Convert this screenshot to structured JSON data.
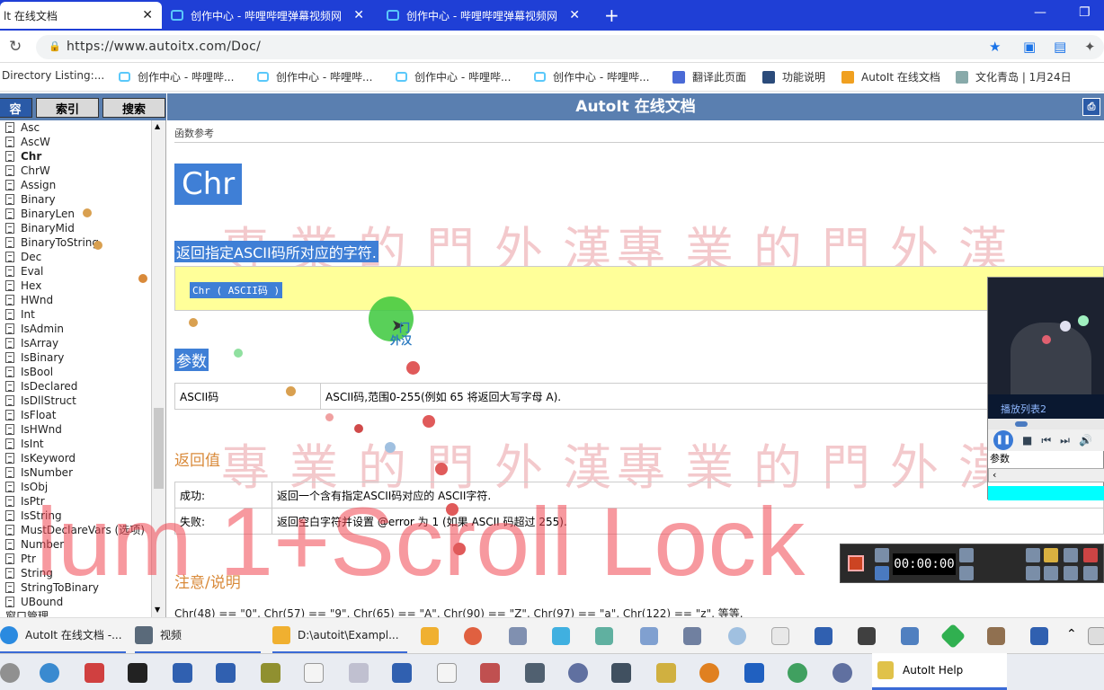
{
  "browser": {
    "tabs": [
      {
        "label": "lt 在线文档",
        "active": true
      },
      {
        "label": "创作中心 - 哔哩哔哩弹幕视频网",
        "active": false
      },
      {
        "label": "创作中心 - 哔哩哔哩弹幕视频网",
        "active": false
      }
    ],
    "new_tab": "+",
    "address": "https://www.autoitx.com/Doc/",
    "bookmarks": [
      "Directory Listing:...",
      "创作中心 - 哔哩哔...",
      "创作中心 - 哔哩哔...",
      "创作中心 - 哔哩哔...",
      "创作中心 - 哔哩哔...",
      "翻译此页面",
      "功能说明",
      "AutoIt 在线文档",
      "文化青岛 | 1月24日"
    ]
  },
  "left_pane": {
    "tabs": [
      "容",
      "索引",
      "搜索"
    ],
    "items": [
      "Asc",
      "AscW",
      "Chr",
      "ChrW",
      "Assign",
      "Binary",
      "BinaryLen",
      "BinaryMid",
      "BinaryToString",
      "Dec",
      "Eval",
      "Hex",
      "HWnd",
      "Int",
      "IsAdmin",
      "IsArray",
      "IsBinary",
      "IsBool",
      "IsDeclared",
      "IsDllStruct",
      "IsFloat",
      "IsHWnd",
      "IsInt",
      "IsKeyword",
      "IsNumber",
      "IsObj",
      "IsPtr",
      "IsString",
      "MustDeclareVars (选项)",
      "Number",
      "Ptr",
      "String",
      "StringToBinary",
      "UBound"
    ],
    "selected_item": "Chr",
    "footer_item": "窗口管理"
  },
  "header": {
    "title": "AutoIt 在线文档"
  },
  "content": {
    "breadcrumb": "函数参考",
    "function_name": "Chr",
    "description": "返回指定ASCII码所对应的字符.",
    "syntax": "Chr ( ASCII码 )",
    "params_heading": "参数",
    "params": [
      {
        "name": "ASCII码",
        "desc": "ASCII码,范围0-255(例如 65 将返回大写字母 A)."
      }
    ],
    "return_heading": "返回值",
    "returns": [
      {
        "label": "成功:",
        "desc": "返回一个含有指定ASCII码对应的 ASCII字符."
      },
      {
        "label": "失败:",
        "desc": "返回空白字符并设置 @error 为 1 (如果 ASCII 码超过 255)."
      }
    ],
    "remarks_heading": "注意/说明",
    "remarks_text": "Chr(48) == \"0\", Chr(57) == \"9\", Chr(65) == \"A\", Chr(90) == \"Z\", Chr(97) == \"a\", Chr(122) == \"z\", 等等."
  },
  "overlays": {
    "watermark_text": "專業的門外漢",
    "big_watermark": "lum 1+Scroll Lock",
    "cursor_label_line1": "门",
    "cursor_label_line2": "外汉"
  },
  "media_player": {
    "playlist": "播放列表2",
    "param_label": "参数"
  },
  "recorder": {
    "time": "00:00:00"
  },
  "taskbar_windows": [
    {
      "label": "AutoIt 在线文档 -..."
    },
    {
      "label": "视频"
    },
    {
      "label": "D:\\autoit\\Exampl..."
    }
  ],
  "taskbar_bottom_active": "AutoIt Help",
  "colors": {
    "tab_bar": "#1f3fd6",
    "header": "#5a7fb0",
    "highlight": "#3f7fd6",
    "syntax_bg": "#ffff99",
    "orange_heading": "#d98a3a"
  }
}
